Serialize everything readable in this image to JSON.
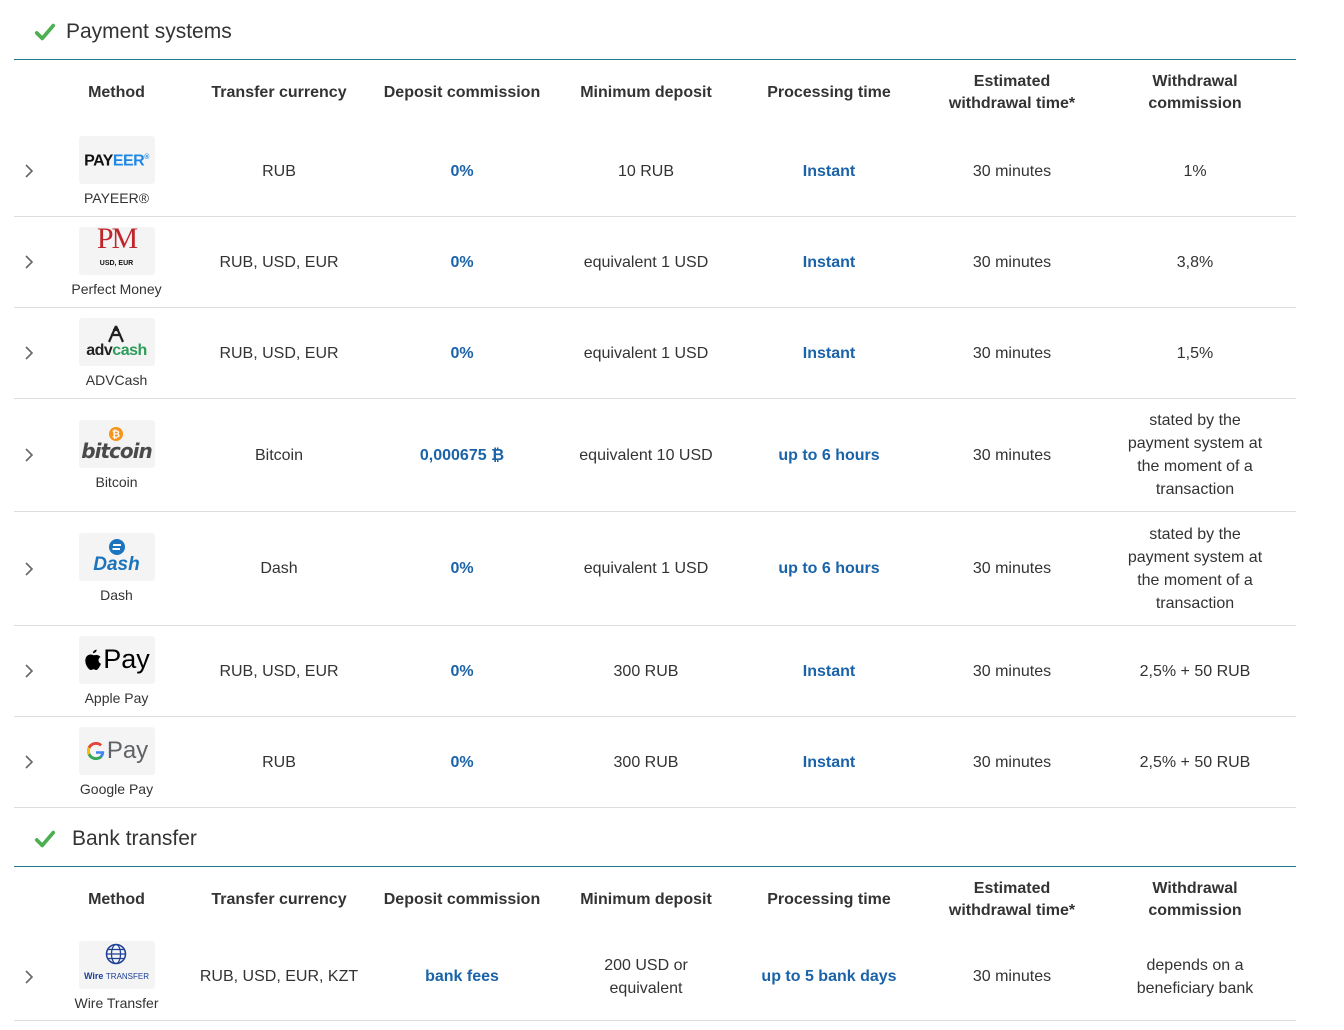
{
  "columns": {
    "method": "Method",
    "currency": "Transfer currency",
    "deposit_commission": "Deposit commission",
    "min_deposit": "Minimum deposit",
    "processing": "Processing time",
    "estimated_line1": "Estimated",
    "estimated_line2": "withdrawal time*",
    "withdrawal_line1": "Withdrawal",
    "withdrawal_line2": "commission"
  },
  "colors": {
    "accent": "#1a63a8",
    "check": "#4caf50",
    "divider": "#1f7a8c"
  },
  "payment_systems": {
    "title": "Payment systems",
    "rows": [
      {
        "logo_text_a": "PAY",
        "logo_text_b": "EER",
        "logo_text_c": "®",
        "label": "PAYEER®",
        "currency": "RUB",
        "deposit": "0%",
        "min": "10 RUB",
        "processing": "Instant",
        "estimated": "30 minutes",
        "withdrawal_a": "1%",
        "withdrawal_b": ""
      },
      {
        "logo_text_a": "PM",
        "logo_text_b": "USD, EUR",
        "label": "Perfect Money",
        "currency": "RUB, USD, EUR",
        "deposit": "0%",
        "min": "equivalent 1 USD",
        "processing": "Instant",
        "estimated": "30 minutes",
        "withdrawal_a": "3,8%",
        "withdrawal_b": ""
      },
      {
        "logo_text_a": "adv",
        "logo_text_b": "cash",
        "label": "ADVCash",
        "currency": "RUB, USD, EUR",
        "deposit": "0%",
        "min": "equivalent 1 USD",
        "processing": "Instant",
        "estimated": "30 minutes",
        "withdrawal_a": "1,5%",
        "withdrawal_b": ""
      },
      {
        "logo_text_a": "bitcoin",
        "label": "Bitcoin",
        "currency": "Bitcoin",
        "deposit": "0,000675 ₿",
        "min": "equivalent 10 USD",
        "processing": "up to 6 hours",
        "estimated": "30 minutes",
        "withdrawal_a": "stated by the",
        "withdrawal_b": "payment system at",
        "withdrawal_c": "the moment of a",
        "withdrawal_d": "transaction"
      },
      {
        "logo_text_a": "Dash",
        "label": "Dash",
        "currency": "Dash",
        "deposit": "0%",
        "min": "equivalent 1 USD",
        "processing": "up to 6 hours",
        "estimated": "30 minutes",
        "withdrawal_a": "stated by the",
        "withdrawal_b": "payment system at",
        "withdrawal_c": "the moment of a",
        "withdrawal_d": "transaction"
      },
      {
        "logo_text_a": "Pay",
        "label": "Apple Pay",
        "currency": "RUB, USD, EUR",
        "deposit": "0%",
        "min": "300 RUB",
        "processing": "Instant",
        "estimated": "30 minutes",
        "withdrawal_a": "2,5% + 50 RUB"
      },
      {
        "logo_text_a": "Pay",
        "label": "Google Pay",
        "currency": "RUB",
        "deposit": "0%",
        "min": "300 RUB",
        "processing": "Instant",
        "estimated": "30 minutes",
        "withdrawal_a": "2,5% + 50 RUB"
      }
    ]
  },
  "bank_transfer": {
    "title": "Bank transfer",
    "rows": [
      {
        "logo_text_a": "Wire",
        "logo_text_b": "TRANSFER",
        "label": "Wire Transfer",
        "currency": "RUB, USD, EUR, KZT",
        "deposit": "bank fees",
        "min_a": "200 USD or",
        "min_b": "equivalent",
        "processing": "up to 5 bank days",
        "estimated": "30 minutes",
        "withdrawal_a": "depends on a",
        "withdrawal_b": "beneficiary bank"
      }
    ]
  }
}
